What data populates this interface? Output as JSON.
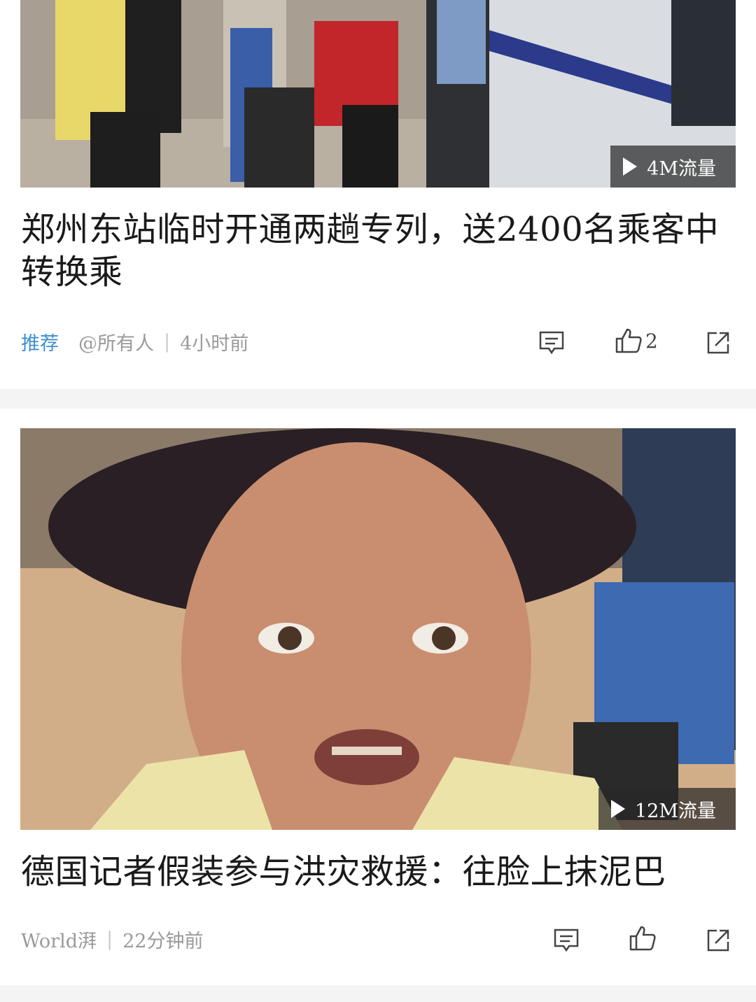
{
  "feed": [
    {
      "badge_text": "4M流量",
      "headline": "郑州东站临时开通两趟专列，送2400名乘客中转换乘",
      "tag": "推荐",
      "source": "@所有人",
      "time": "4小时前",
      "like_count": "2"
    },
    {
      "badge_text": "12M流量",
      "headline": "德国记者假装参与洪灾救援：往脸上抹泥巴",
      "source": "World湃",
      "time": "22分钟前",
      "like_count": ""
    }
  ],
  "colors": {
    "tag": "#3d8fd0",
    "meta": "#9a9a9a",
    "divider_band": "#f4f4f4"
  },
  "icons": [
    "play-icon",
    "comment-icon",
    "thumbs-up-icon",
    "share-icon"
  ]
}
